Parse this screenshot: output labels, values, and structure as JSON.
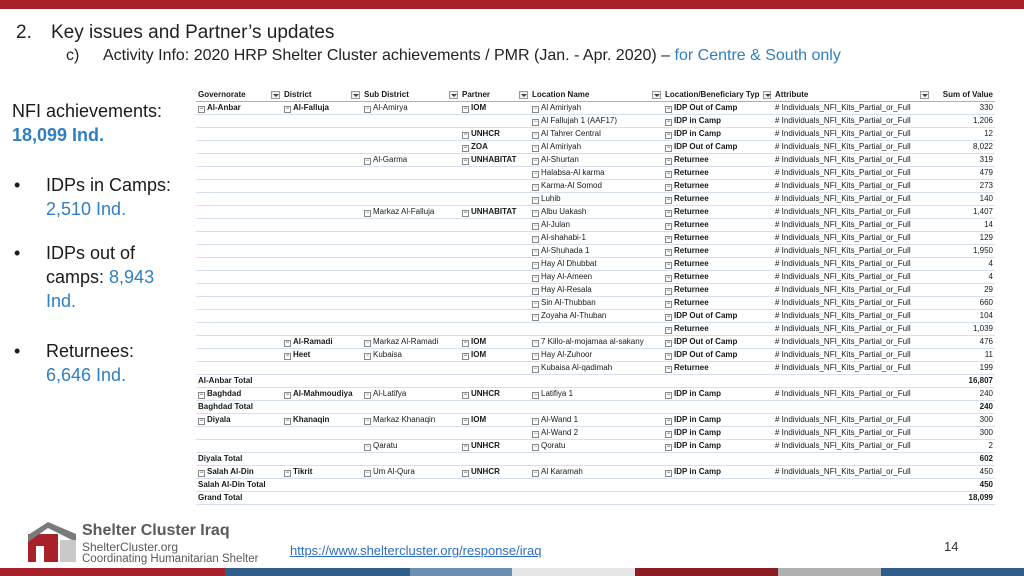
{
  "header": {
    "number": "2.",
    "title": "Key issues and Partner’s updates",
    "sub_letter": "c)",
    "sub_title": "Activity Info: 2020 HRP Shelter Cluster achievements / PMR (Jan. - Apr. 2020) –",
    "sub_highlight": "for Centre & South only"
  },
  "summary": {
    "nfi_label": "NFI achievements:",
    "nfi_value": "18,099 Ind.",
    "bullets": [
      {
        "label": "IDPs in Camps:",
        "value": "2,510 Ind."
      },
      {
        "label": "IDPs out of camps",
        "value": "8,943 Ind."
      },
      {
        "label": "Returnees:",
        "value": "6,646 Ind."
      }
    ]
  },
  "table": {
    "headers": [
      "Governorate",
      "District",
      "Sub District",
      "Partner",
      "Location Name",
      "Location/Beneficiary Typ",
      "Attribute",
      "Sum of Value"
    ],
    "rows": [
      {
        "gov": "Al-Anbar",
        "dist": "Al-Falluja",
        "sub": "Al-Amirya",
        "partner": "IOM",
        "loc": "Al Amiriyah",
        "type": "IDP Out of Camp",
        "attr": "# Individuals_NFI_Kits_Partial_or_Full",
        "val": "330"
      },
      {
        "gov": "",
        "dist": "",
        "sub": "",
        "partner": "",
        "loc": "Al Fallujah 1 (AAF17)",
        "type": "IDP in Camp",
        "attr": "# Individuals_NFI_Kits_Partial_or_Full",
        "val": "1,206"
      },
      {
        "gov": "",
        "dist": "",
        "sub": "",
        "partner": "UNHCR",
        "loc": "Al Tahrer Central",
        "type": "IDP in Camp",
        "attr": "# Individuals_NFI_Kits_Partial_or_Full",
        "val": "12"
      },
      {
        "gov": "",
        "dist": "",
        "sub": "",
        "partner": "ZOA",
        "loc": "Al Amiriyah",
        "type": "IDP Out of Camp",
        "attr": "# Individuals_NFI_Kits_Partial_or_Full",
        "val": "8,022"
      },
      {
        "gov": "",
        "dist": "",
        "sub": "Al-Garma",
        "partner": "UNHABITAT",
        "loc": "Al-Shurtan",
        "type": "Returnee",
        "attr": "# Individuals_NFI_Kits_Partial_or_Full",
        "val": "319"
      },
      {
        "gov": "",
        "dist": "",
        "sub": "",
        "partner": "",
        "loc": "Halabsa-Al karma",
        "type": "Returnee",
        "attr": "# Individuals_NFI_Kits_Partial_or_Full",
        "val": "479"
      },
      {
        "gov": "",
        "dist": "",
        "sub": "",
        "partner": "",
        "loc": "Karma-Al Somod",
        "type": "Returnee",
        "attr": "# Individuals_NFI_Kits_Partial_or_Full",
        "val": "273"
      },
      {
        "gov": "",
        "dist": "",
        "sub": "",
        "partner": "",
        "loc": "Luhib",
        "type": "Returnee",
        "attr": "# Individuals_NFI_Kits_Partial_or_Full",
        "val": "140"
      },
      {
        "gov": "",
        "dist": "",
        "sub": "Markaz Al-Falluja",
        "partner": "UNHABITAT",
        "loc": "Albu Uakash",
        "type": "Returnee",
        "attr": "# Individuals_NFI_Kits_Partial_or_Full",
        "val": "1,407"
      },
      {
        "gov": "",
        "dist": "",
        "sub": "",
        "partner": "",
        "loc": "Al-Julan",
        "type": "Returnee",
        "attr": "# Individuals_NFI_Kits_Partial_or_Full",
        "val": "14"
      },
      {
        "gov": "",
        "dist": "",
        "sub": "",
        "partner": "",
        "loc": "Al-shahabi-1",
        "type": "Returnee",
        "attr": "# Individuals_NFI_Kits_Partial_or_Full",
        "val": "129"
      },
      {
        "gov": "",
        "dist": "",
        "sub": "",
        "partner": "",
        "loc": "Al-Shuhada 1",
        "type": "Returnee",
        "attr": "# Individuals_NFI_Kits_Partial_or_Full",
        "val": "1,950"
      },
      {
        "gov": "",
        "dist": "",
        "sub": "",
        "partner": "",
        "loc": "Hay Al Dhubbat",
        "type": "Returnee",
        "attr": "# Individuals_NFI_Kits_Partial_or_Full",
        "val": "4"
      },
      {
        "gov": "",
        "dist": "",
        "sub": "",
        "partner": "",
        "loc": "Hay Al-Ameen",
        "type": "Returnee",
        "attr": "# Individuals_NFI_Kits_Partial_or_Full",
        "val": "4"
      },
      {
        "gov": "",
        "dist": "",
        "sub": "",
        "partner": "",
        "loc": "Hay Al-Resala",
        "type": "Returnee",
        "attr": "# Individuals_NFI_Kits_Partial_or_Full",
        "val": "29"
      },
      {
        "gov": "",
        "dist": "",
        "sub": "",
        "partner": "",
        "loc": "Sin Al-Thubban",
        "type": "Returnee",
        "attr": "# Individuals_NFI_Kits_Partial_or_Full",
        "val": "660"
      },
      {
        "gov": "",
        "dist": "",
        "sub": "",
        "partner": "",
        "loc": "Zoyaha Al-Thuban",
        "type": "IDP Out of Camp",
        "attr": "# Individuals_NFI_Kits_Partial_or_Full",
        "val": "104"
      },
      {
        "gov": "",
        "dist": "",
        "sub": "",
        "partner": "",
        "loc": "",
        "type": "Returnee",
        "attr": "# Individuals_NFI_Kits_Partial_or_Full",
        "val": "1,039"
      },
      {
        "gov": "",
        "dist": "Al-Ramadi",
        "sub": "Markaz Al-Ramadi",
        "partner": "IOM",
        "loc": "7 Killo-al-mojamaa al-sakany",
        "type": "IDP Out of Camp",
        "attr": "# Individuals_NFI_Kits_Partial_or_Full",
        "val": "476"
      },
      {
        "gov": "",
        "dist": "Heet",
        "sub": "Kubaisa",
        "partner": "IOM",
        "loc": "Hay Al-Zuhoor",
        "type": "IDP Out of Camp",
        "attr": "# Individuals_NFI_Kits_Partial_or_Full",
        "val": "11"
      },
      {
        "gov": "",
        "dist": "",
        "sub": "",
        "partner": "",
        "loc": "Kubaisa Al-qadimah",
        "type": "Returnee",
        "attr": "# Individuals_NFI_Kits_Partial_or_Full",
        "val": "199"
      },
      {
        "total": "Al-Anbar Total",
        "val": "16,807"
      },
      {
        "gov": "Baghdad",
        "dist": "Al-Mahmoudiya",
        "sub": "Al-Latifya",
        "partner": "UNHCR",
        "loc": "Latifiya 1",
        "type": "IDP in Camp",
        "attr": "# Individuals_NFI_Kits_Partial_or_Full",
        "val": "240"
      },
      {
        "total": "Baghdad Total",
        "val": "240"
      },
      {
        "gov": "Diyala",
        "dist": "Khanaqin",
        "sub": "Markaz Khanaqin",
        "partner": "IOM",
        "loc": "Al-Wand 1",
        "type": "IDP in Camp",
        "attr": "# Individuals_NFI_Kits_Partial_or_Full",
        "val": "300"
      },
      {
        "gov": "",
        "dist": "",
        "sub": "",
        "partner": "",
        "loc": "Al-Wand 2",
        "type": "IDP in Camp",
        "attr": "# Individuals_NFI_Kits_Partial_or_Full",
        "val": "300"
      },
      {
        "gov": "",
        "dist": "",
        "sub": "Qaratu",
        "partner": "UNHCR",
        "loc": "Qoratu",
        "type": "IDP in Camp",
        "attr": "# Individuals_NFI_Kits_Partial_or_Full",
        "val": "2"
      },
      {
        "total": "Diyala Total",
        "val": "602"
      },
      {
        "gov": "Salah Al-Din",
        "dist": "Tikrit",
        "sub": "Um Al-Qura",
        "partner": "UNHCR",
        "loc": "Al Karamah",
        "type": "IDP in Camp",
        "attr": "# Individuals_NFI_Kits_Partial_or_Full",
        "val": "450"
      },
      {
        "total": "Salah Al-Din Total",
        "val": "450"
      },
      {
        "total": "Grand Total",
        "val": "18,099"
      }
    ]
  },
  "footer": {
    "logo_title": "Shelter Cluster Iraq",
    "logo_site": "ShelterCluster.org",
    "logo_tagline": "Coordinating Humanitarian Shelter",
    "url": "https://www.sheltercluster.org/response/iraq",
    "page_number": "14"
  },
  "colors": {
    "brand_red": "#a8212a",
    "accent_blue": "#2f7fc1",
    "strip": [
      "#a8212a",
      "#2e5f8a",
      "#6a8fb0",
      "#e6e6e6",
      "#8c1c24",
      "#b0b0b0",
      "#2e5f8a"
    ]
  }
}
